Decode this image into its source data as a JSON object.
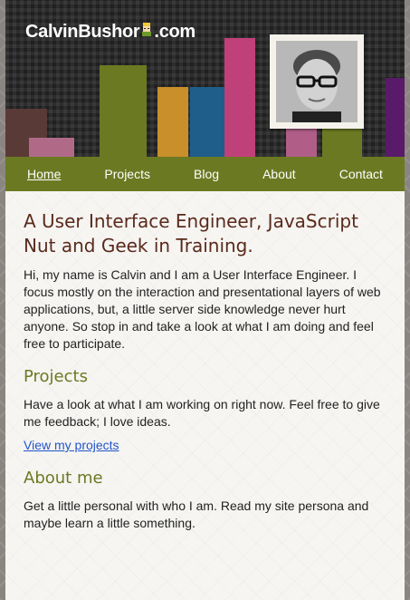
{
  "header": {
    "logo_text_left": "CalvinBushor",
    "logo_text_right": "com",
    "mascot_icon": "mascot-icon"
  },
  "nav": {
    "items": [
      {
        "label": "Home"
      },
      {
        "label": "Projects"
      },
      {
        "label": "Blog"
      },
      {
        "label": "About"
      },
      {
        "label": "Contact"
      }
    ]
  },
  "main": {
    "title": "A User Interface Engineer, JavaScript Nut and Geek in Training.",
    "intro": "Hi, my name is Calvin and I am a User Interface Engineer. I focus mostly on the interaction and presentational layers of web applications, but, a little server side knowledge never hurt anyone. So stop in and take a look at what I am doing and feel free to participate.",
    "projects_heading": "Projects",
    "projects_text": "Have a look at what I am working on right now. Feel free to give me feedback; I love ideas.",
    "projects_link": "View my projects",
    "about_heading": "About me",
    "about_text": "Get a little personal with who I am. Read my site persona and maybe learn a little something."
  },
  "colors": {
    "nav": "#6b7a22",
    "title": "#5a2a1c",
    "heading": "#6b7a22",
    "link": "#2255cc"
  }
}
